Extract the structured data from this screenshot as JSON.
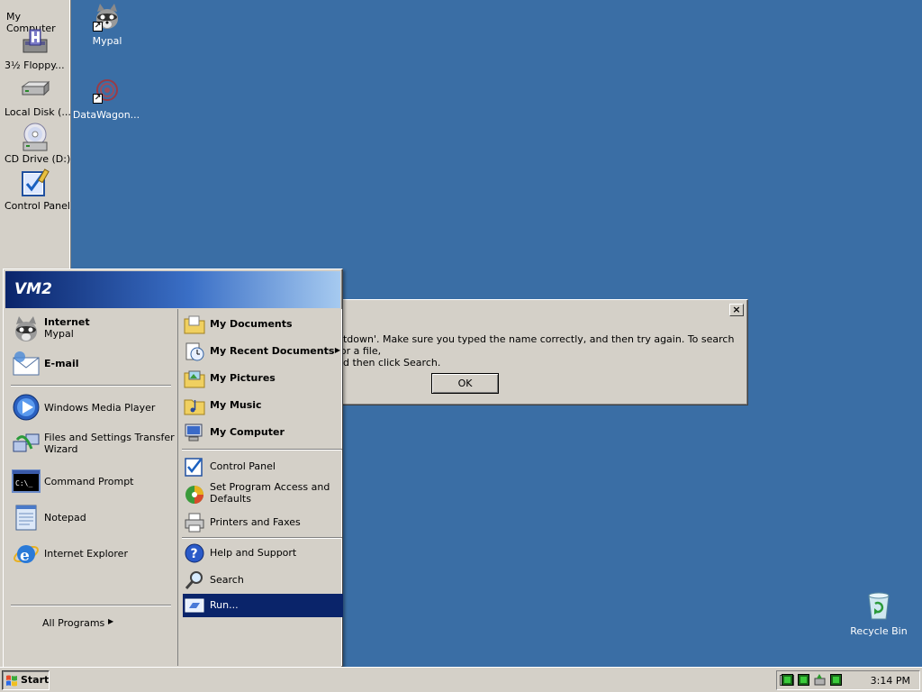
{
  "drive_panel": {
    "title": "My Computer",
    "items": [
      {
        "label": "3½ Floppy...",
        "icon": "floppy-icon"
      },
      {
        "label": "Local Disk (...",
        "icon": "hard-disk-icon"
      },
      {
        "label": "CD Drive (D:)",
        "icon": "cd-drive-icon"
      },
      {
        "label": "Control Panel",
        "icon": "control-panel-icon"
      }
    ]
  },
  "desktop": {
    "background_color": "#3a6ea5",
    "icons": [
      {
        "label": "Mypal",
        "icon": "raccoon-icon"
      },
      {
        "label": "DataWagon...",
        "icon": "datawagon-icon"
      },
      {
        "label": "Recycle Bin",
        "icon": "recycle-bin-icon"
      }
    ]
  },
  "error_dialog": {
    "message_line1": "utdown'. Make sure you typed the name correctly, and then try again. To search for a file,",
    "message_line2": "nd then click Search.",
    "ok_label": "OK",
    "close_label": "×"
  },
  "start_menu": {
    "user_name": "VM2",
    "pinned": [
      {
        "title": "Internet",
        "subtitle": "Mypal",
        "icon": "raccoon-icon"
      },
      {
        "title": "E-mail",
        "icon": "email-icon"
      }
    ],
    "recent": [
      {
        "label": "Windows Media Player",
        "icon": "media-player-icon"
      },
      {
        "label1": "Files and Settings Transfer",
        "label2": "Wizard",
        "icon": "transfer-wizard-icon"
      },
      {
        "label": "Command Prompt",
        "icon": "command-prompt-icon"
      },
      {
        "label": "Notepad",
        "icon": "notepad-icon"
      },
      {
        "label": "Internet Explorer",
        "icon": "internet-explorer-icon"
      }
    ],
    "all_programs": "All Programs",
    "right_bold": [
      {
        "label": "My Documents",
        "icon": "documents-folder-icon"
      },
      {
        "label": "My Recent Documents",
        "icon": "recent-documents-icon"
      },
      {
        "label": "My Pictures",
        "icon": "pictures-folder-icon"
      },
      {
        "label": "My Music",
        "icon": "music-folder-icon"
      },
      {
        "label": "My Computer",
        "icon": "my-computer-icon"
      }
    ],
    "right_settings": [
      {
        "label": "Control Panel",
        "icon": "control-panel-icon"
      },
      {
        "label1": "Set Program Access and",
        "label2": "Defaults",
        "icon": "program-access-icon"
      },
      {
        "label": "Printers and Faxes",
        "icon": "printer-icon"
      }
    ],
    "right_tools": [
      {
        "label": "Help and Support",
        "icon": "help-icon"
      },
      {
        "label": "Search",
        "icon": "search-icon"
      },
      {
        "label": "Run...",
        "icon": "run-icon",
        "selected": true
      }
    ],
    "selection_color": "#0a246a"
  },
  "taskbar": {
    "start_label": "Start",
    "clock": "3:14 PM"
  }
}
